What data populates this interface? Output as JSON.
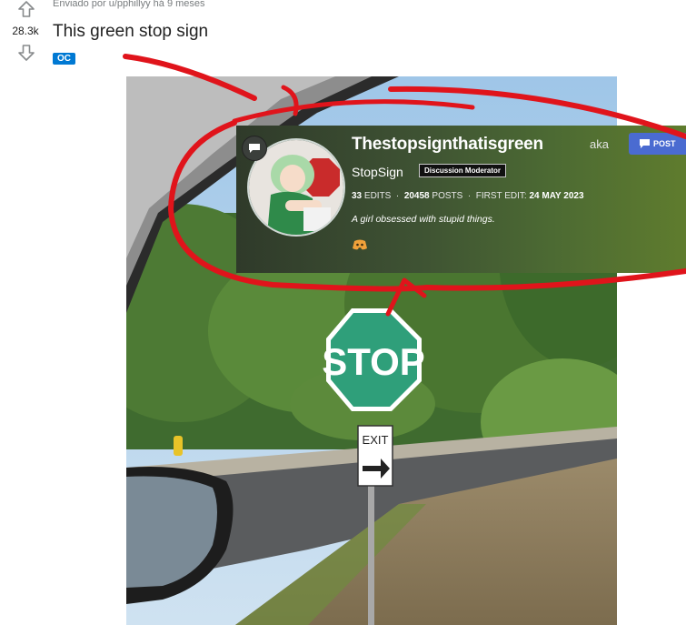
{
  "post": {
    "meta": "Enviado por  u/pphillyy há 9 meses",
    "score": "28.3k",
    "title": "This green stop sign",
    "flair": "OC"
  },
  "profile_card": {
    "username": "Thestopsignthatisgreen",
    "aka": "aka",
    "post_button": "POST",
    "alias": "StopSign",
    "role_badge": "Discussion Moderator",
    "edits_count": "33",
    "edits_label": "EDITS",
    "posts_count": "20458",
    "posts_label": "POSTS",
    "first_edit_label": "FIRST EDIT:",
    "first_edit_date": "24 MAY 2023",
    "bio": "A girl obsessed with stupid things."
  },
  "photo": {
    "sign_text": "STOP",
    "exit_text": "EXIT"
  },
  "colors": {
    "sign_green": "#2f9f7a",
    "annotation_red": "#e0141b",
    "flair_blue": "#0079d3"
  },
  "icons": [
    "upvote-arrow-icon",
    "downvote-arrow-icon",
    "chat-bubble-icon",
    "discord-icon",
    "post-icon"
  ]
}
